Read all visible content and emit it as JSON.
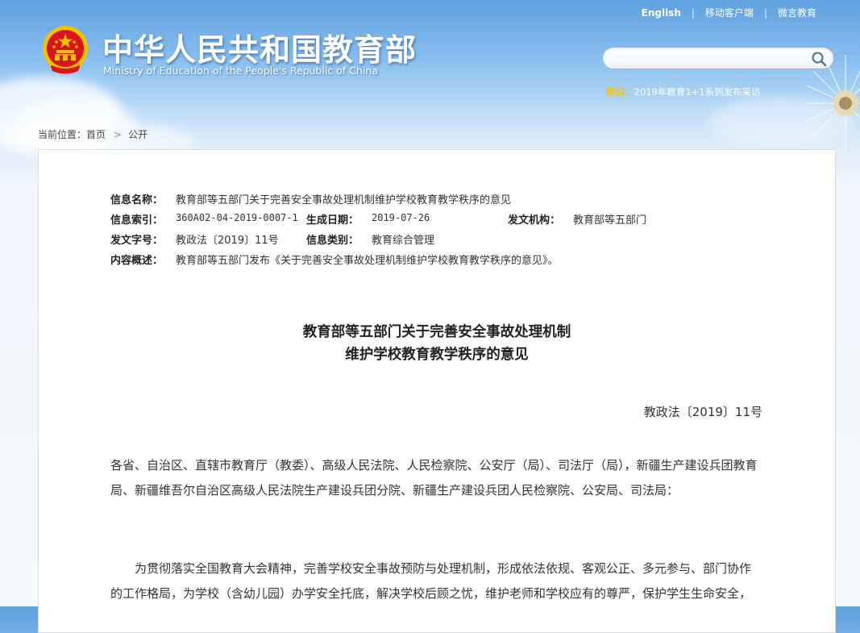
{
  "header": {
    "title_cn": "中华人民共和国教育部",
    "title_en": "Ministry of Education of the People's Republic of China",
    "top_links": [
      "English",
      "移动客户端",
      "微言教育"
    ],
    "search": {
      "value": "",
      "placeholder": ""
    },
    "hot": {
      "label": "热词：",
      "text": "2019年教育1+1系列发布采访"
    }
  },
  "breadcrumb": {
    "prefix": "当前位置：",
    "home": "首页",
    "current": "公开"
  },
  "meta": {
    "name_label": "信息名称：",
    "name_value": "教育部等五部门关于完善安全事故处理机制维护学校教育教学秩序的意见",
    "index_label": "信息索引：",
    "index_value": "360A02-04-2019-0007-1",
    "date_label": "生成日期：",
    "date_value": "2019-07-26",
    "org_label": "发文机构：",
    "org_value": "教育部等五部门",
    "docno_label": "发文字号：",
    "docno_value": "教政法〔2019〕11号",
    "category_label": "信息类别：",
    "category_value": "教育综合管理",
    "summary_label": "内容概述：",
    "summary_value": "教育部等五部门发布《关于完善安全事故处理机制维护学校教育教学秩序的意见》。"
  },
  "document": {
    "title_line1": "教育部等五部门关于完善安全事故处理机制",
    "title_line2": "维护学校教育教学秩序的意见",
    "number": "教政法〔2019〕11号",
    "recipients": "各省、自治区、直辖市教育厅（教委）、高级人民法院、人民检察院、公安厅（局）、司法厅（局），新疆生产建设兵团教育局、新疆维吾尔自治区高级人民法院生产建设兵团分院、新疆生产建设兵团人民检察院、公安局、司法局：",
    "paragraph1": "为贯彻落实全国教育大会精神，完善学校安全事故预防与处理机制，形成依法依规、客观公正、多元参与、部门协作的工作格局，为学校（含幼儿园）办学安全托底，解决学校后顾之忧，维护老师和学校应有的尊严，保护学生生命安全，"
  },
  "colors": {
    "hot_label": "#f7c600",
    "header_sky": "#5fa0df",
    "emblem_red": "#d7151a",
    "emblem_gold": "#f2c200"
  }
}
